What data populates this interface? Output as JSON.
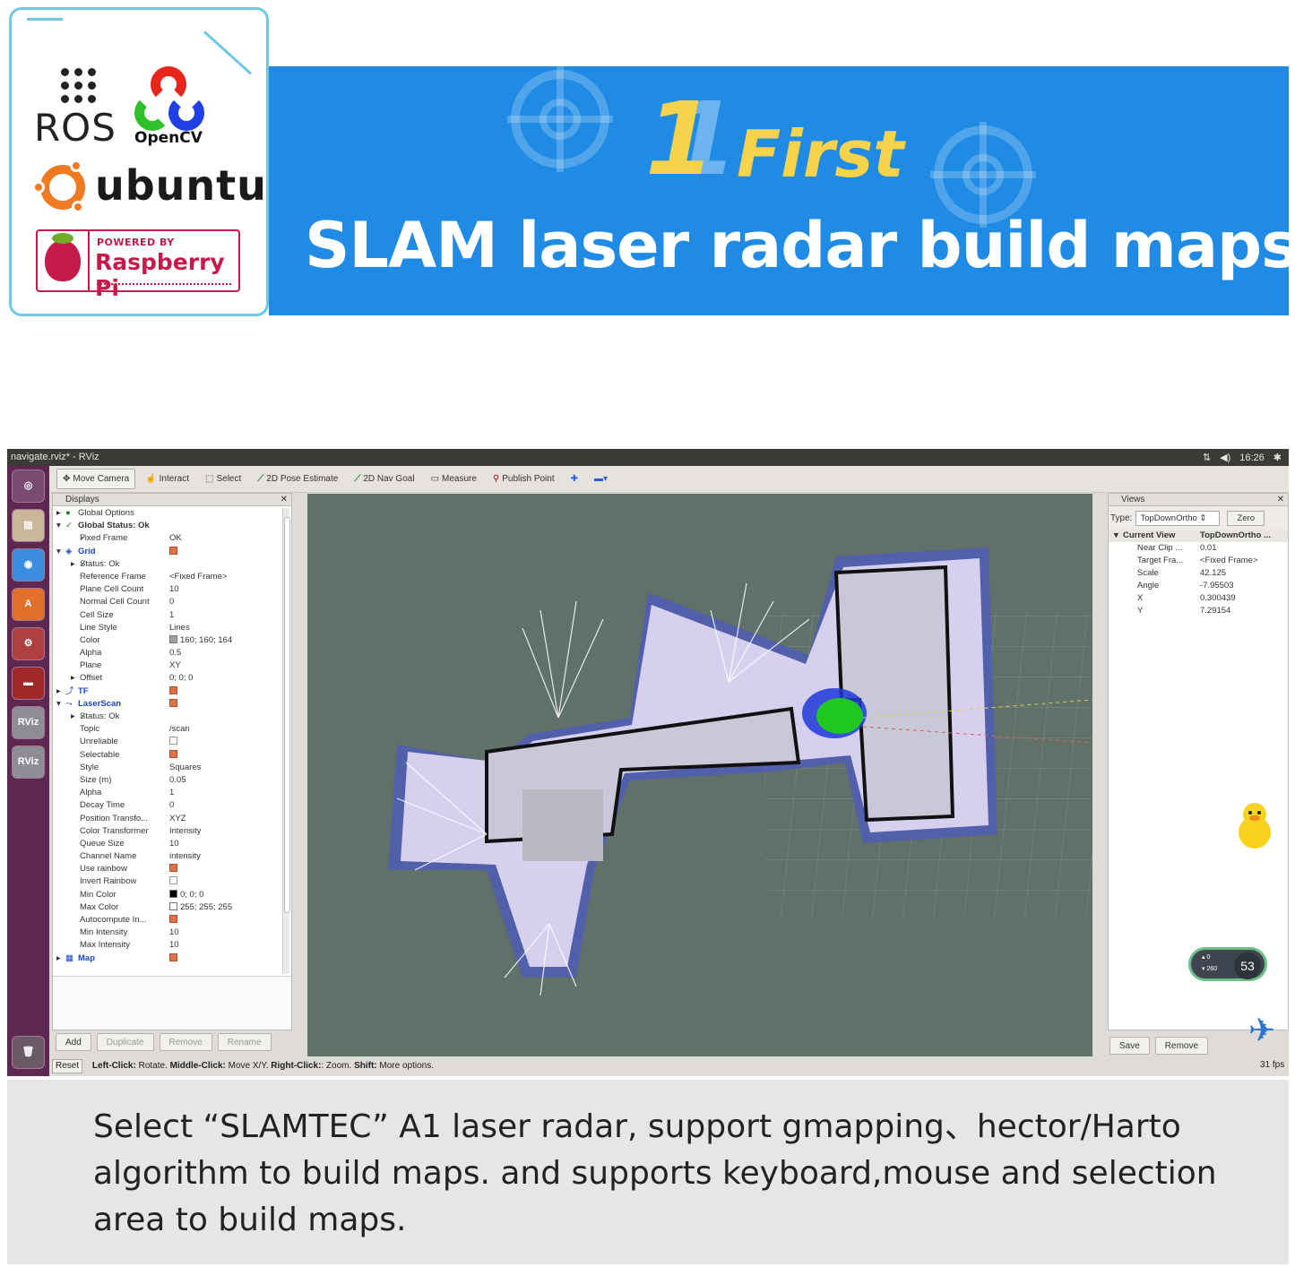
{
  "banner": {
    "number": "1",
    "first": "First",
    "headline": "SLAM laser radar build maps"
  },
  "logos": {
    "ros": "ROS",
    "opencv": "OpenCV",
    "ubuntu": "ubuntu",
    "rpi_small": "POWERED BY",
    "rpi_big": "Raspberry Pi"
  },
  "rviz": {
    "window_title": "navigate.rviz* - RViz",
    "clock": "16:26",
    "toolbar": {
      "move_camera": "Move Camera",
      "interact": "Interact",
      "select": "Select",
      "pose_estimate": "2D Pose Estimate",
      "nav_goal": "2D Nav Goal",
      "measure": "Measure",
      "publish_point": "Publish Point"
    },
    "displays": {
      "title": "Displays",
      "rows": [
        {
          "indent": 1,
          "arrow": "▸",
          "icon": "●",
          "key": "Global Options",
          "value": "",
          "style": ""
        },
        {
          "indent": 1,
          "arrow": "▾",
          "icon": "✓",
          "key": "Global Status: Ok",
          "value": "",
          "style": "bold"
        },
        {
          "indent": 2,
          "arrow": "",
          "icon": "✓",
          "key": "Fixed Frame",
          "value": "OK",
          "style": ""
        },
        {
          "indent": 1,
          "arrow": "▾",
          "icon": "◈",
          "key": "Grid",
          "value": "",
          "check": true,
          "style": "blue"
        },
        {
          "indent": 2,
          "arrow": "▸",
          "icon": "✓",
          "key": "Status: Ok",
          "value": "",
          "style": ""
        },
        {
          "indent": 2,
          "arrow": "",
          "icon": "",
          "key": "Reference Frame",
          "value": "<Fixed Frame>",
          "style": ""
        },
        {
          "indent": 2,
          "arrow": "",
          "icon": "",
          "key": "Plane Cell Count",
          "value": "10",
          "style": ""
        },
        {
          "indent": 2,
          "arrow": "",
          "icon": "",
          "key": "Normal Cell Count",
          "value": "0",
          "style": ""
        },
        {
          "indent": 2,
          "arrow": "",
          "icon": "",
          "key": "Cell Size",
          "value": "1",
          "style": ""
        },
        {
          "indent": 2,
          "arrow": "",
          "icon": "",
          "key": "Line Style",
          "value": "Lines",
          "style": ""
        },
        {
          "indent": 2,
          "arrow": "",
          "icon": "",
          "key": "Color",
          "value": "160; 160; 164",
          "swatch": "#a0a0a4",
          "style": ""
        },
        {
          "indent": 2,
          "arrow": "",
          "icon": "",
          "key": "Alpha",
          "value": "0.5",
          "style": ""
        },
        {
          "indent": 2,
          "arrow": "",
          "icon": "",
          "key": "Plane",
          "value": "XY",
          "style": ""
        },
        {
          "indent": 2,
          "arrow": "▸",
          "icon": "",
          "key": "Offset",
          "value": "0; 0; 0",
          "style": ""
        },
        {
          "indent": 1,
          "arrow": "▸",
          "icon": "⤴",
          "key": "TF",
          "value": "",
          "check": true,
          "style": "blue"
        },
        {
          "indent": 1,
          "arrow": "▾",
          "icon": "⤳",
          "key": "LaserScan",
          "value": "",
          "check": true,
          "style": "blue"
        },
        {
          "indent": 2,
          "arrow": "▸",
          "icon": "✓",
          "key": "Status: Ok",
          "value": "",
          "style": ""
        },
        {
          "indent": 2,
          "arrow": "",
          "icon": "",
          "key": "Topic",
          "value": "/scan",
          "style": ""
        },
        {
          "indent": 2,
          "arrow": "",
          "icon": "",
          "key": "Unreliable",
          "value": "",
          "check": false,
          "style": ""
        },
        {
          "indent": 2,
          "arrow": "",
          "icon": "",
          "key": "Selectable",
          "value": "",
          "check": true,
          "style": ""
        },
        {
          "indent": 2,
          "arrow": "",
          "icon": "",
          "key": "Style",
          "value": "Squares",
          "style": ""
        },
        {
          "indent": 2,
          "arrow": "",
          "icon": "",
          "key": "Size (m)",
          "value": "0.05",
          "style": ""
        },
        {
          "indent": 2,
          "arrow": "",
          "icon": "",
          "key": "Alpha",
          "value": "1",
          "style": ""
        },
        {
          "indent": 2,
          "arrow": "",
          "icon": "",
          "key": "Decay Time",
          "value": "0",
          "style": ""
        },
        {
          "indent": 2,
          "arrow": "",
          "icon": "",
          "key": "Position Transfo...",
          "value": "XYZ",
          "style": ""
        },
        {
          "indent": 2,
          "arrow": "",
          "icon": "",
          "key": "Color Transformer",
          "value": "Intensity",
          "style": ""
        },
        {
          "indent": 2,
          "arrow": "",
          "icon": "",
          "key": "Queue Size",
          "value": "10",
          "style": ""
        },
        {
          "indent": 2,
          "arrow": "",
          "icon": "",
          "key": "Channel Name",
          "value": "intensity",
          "style": ""
        },
        {
          "indent": 2,
          "arrow": "",
          "icon": "",
          "key": "Use rainbow",
          "value": "",
          "check": true,
          "style": ""
        },
        {
          "indent": 2,
          "arrow": "",
          "icon": "",
          "key": "Invert Rainbow",
          "value": "",
          "check": false,
          "style": ""
        },
        {
          "indent": 2,
          "arrow": "",
          "icon": "",
          "key": "Min Color",
          "value": "0; 0; 0",
          "swatch": "#000000",
          "style": ""
        },
        {
          "indent": 2,
          "arrow": "",
          "icon": "",
          "key": "Max Color",
          "value": "255; 255; 255",
          "swatch": "#ffffff",
          "style": ""
        },
        {
          "indent": 2,
          "arrow": "",
          "icon": "",
          "key": "Autocompute In...",
          "value": "",
          "check": true,
          "style": ""
        },
        {
          "indent": 2,
          "arrow": "",
          "icon": "",
          "key": "Min Intensity",
          "value": "10",
          "style": ""
        },
        {
          "indent": 2,
          "arrow": "",
          "icon": "",
          "key": "Max Intensity",
          "value": "10",
          "style": ""
        },
        {
          "indent": 1,
          "arrow": "▸",
          "icon": "▦",
          "key": "Map",
          "value": "",
          "check": true,
          "style": "blue"
        }
      ],
      "buttons": {
        "add": "Add",
        "duplicate": "Duplicate",
        "remove": "Remove",
        "rename": "Rename"
      }
    },
    "views": {
      "title": "Views",
      "type_label": "Type:",
      "type_value": "TopDownOrtho",
      "zero": "Zero",
      "header_key": "Current View",
      "header_value": "TopDownOrtho ...",
      "rows": [
        {
          "key": "Near Clip ...",
          "value": "0.01"
        },
        {
          "key": "Target Fra...",
          "value": "<Fixed Frame>"
        },
        {
          "key": "Scale",
          "value": "42.125"
        },
        {
          "key": "Angle",
          "value": "-7.95503"
        },
        {
          "key": "X",
          "value": "0.300439"
        },
        {
          "key": "Y",
          "value": "7.29154"
        }
      ],
      "save": "Save",
      "remove": "Remove"
    },
    "status": {
      "reset": "Reset",
      "help_left": "Left-Click:",
      "help_left_t": " Rotate. ",
      "help_mid": "Middle-Click:",
      "help_mid_t": " Move X/Y. ",
      "help_right": "Right-Click:",
      "help_right_t": ": Zoom. ",
      "help_shift": "Shift:",
      "help_shift_t": " More options."
    },
    "meter": {
      "pct": "53",
      "up": "0",
      "down": "260"
    },
    "fps": "31 fps"
  },
  "caption": "Select “SLAMTEC” A1 laser radar, support gmapping、hector/Harto algorithm to build maps. and supports keyboard,mouse and selection area to build maps.",
  "colors": {
    "banner": "#1f8be4",
    "accent_yellow": "#f6d34a",
    "launcher": "#5e2750"
  }
}
